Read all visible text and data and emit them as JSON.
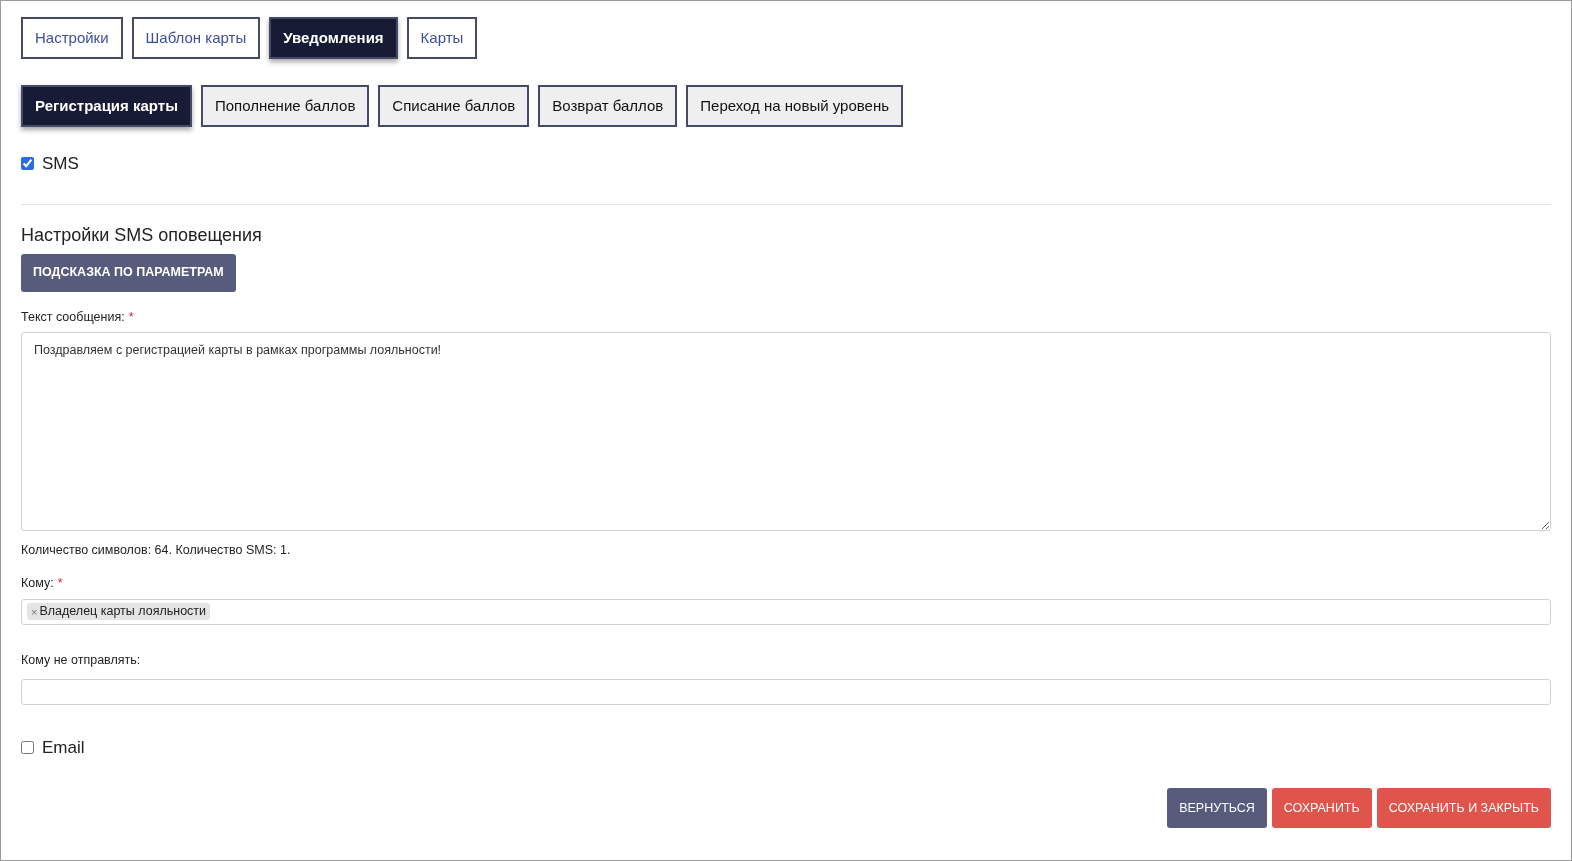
{
  "tabs": [
    {
      "label": "Настройки",
      "selected": false
    },
    {
      "label": "Шаблон карты",
      "selected": false
    },
    {
      "label": "Уведомления",
      "selected": true
    },
    {
      "label": "Карты",
      "selected": false
    }
  ],
  "event_tabs": [
    {
      "label": "Регистрация карты",
      "selected": true
    },
    {
      "label": "Пополнение баллов",
      "selected": false
    },
    {
      "label": "Списание баллов",
      "selected": false
    },
    {
      "label": "Возврат баллов",
      "selected": false
    },
    {
      "label": "Переход на новый уровень",
      "selected": false
    }
  ],
  "sms": {
    "label": "SMS",
    "checked": true
  },
  "sms_settings": {
    "title": "Настройки SMS оповещения",
    "hint_button": "ПОДСКАЗКА ПО ПАРАМЕТРАМ",
    "message_label": "Текст сообщения:",
    "message_required": "*",
    "message": "Поздравляем с регистрацией карты в рамках программы лояльности!",
    "counter": "Количество символов: 64. Количество SMS: 1.",
    "to_label": "Кому:",
    "to_required": "*",
    "to_tags": [
      {
        "remove": "×",
        "label": "Владелец карты лояльности"
      }
    ],
    "exclude_label": "Кому не отправлять:"
  },
  "email": {
    "label": "Email",
    "checked": false
  },
  "buttons": [
    {
      "label": "ВЕРНУТЬСЯ",
      "kind": "secondary"
    },
    {
      "label": "СОХРАНИТЬ",
      "kind": "danger"
    },
    {
      "label": "СОХРАНИТЬ И ЗАКРЫТЬ",
      "kind": "danger"
    }
  ]
}
